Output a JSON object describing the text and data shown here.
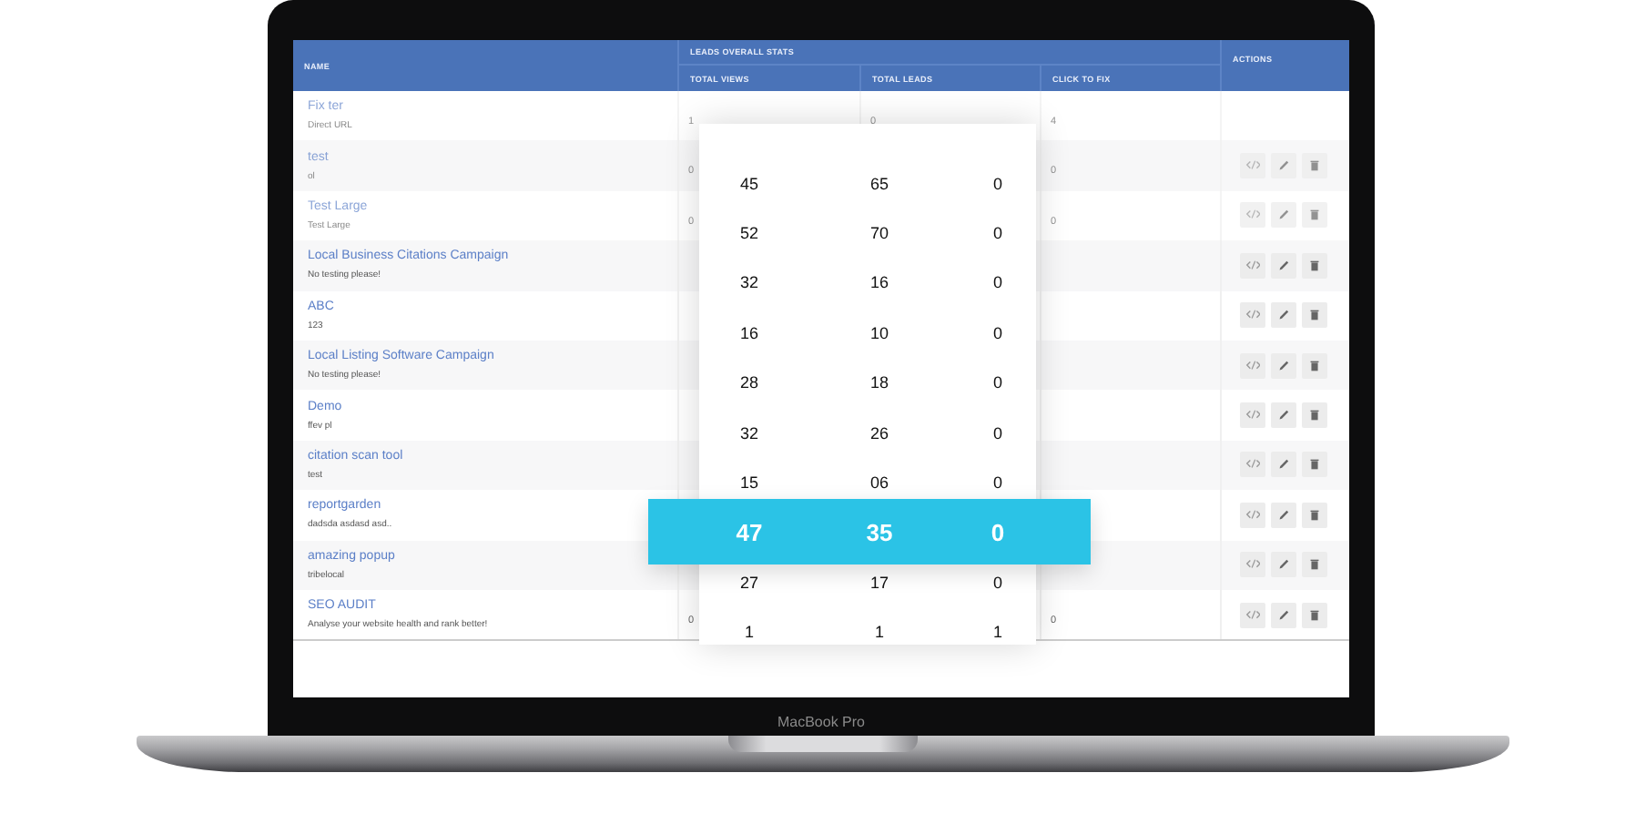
{
  "device": {
    "label": "MacBook Pro"
  },
  "table": {
    "columns": {
      "name": "NAME",
      "group": "LEADS OVERALL STATS",
      "stats": [
        "TOTAL VIEWS",
        "TOTAL LEADS",
        "CLICK TO FIX"
      ],
      "actions": "ACTIONS"
    },
    "rows": [
      {
        "name": "Fix ter",
        "description": "Direct URL",
        "faded": true,
        "has_actions": false,
        "stats": {
          "views": "1",
          "leads": "0",
          "click_to_fix": "4"
        }
      },
      {
        "name": "test",
        "description": "ol",
        "faded": true,
        "has_actions": true,
        "stats": {
          "views": "0",
          "click_to_fix": "0"
        }
      },
      {
        "name": "Test Large",
        "description": "Test Large",
        "faded": true,
        "has_actions": true,
        "stats": {
          "views": "0",
          "click_to_fix": "0"
        }
      },
      {
        "name": "Local Business Citations Campaign",
        "description": "No testing please!",
        "faded": false,
        "has_actions": true
      },
      {
        "name": "ABC",
        "description": "123",
        "faded": false,
        "has_actions": true
      },
      {
        "name": "Local Listing Software Campaign",
        "description": "No testing please!",
        "faded": false,
        "has_actions": true
      },
      {
        "name": "Demo",
        "description": "ffev pl",
        "faded": false,
        "has_actions": true
      },
      {
        "name": "citation scan tool",
        "description": "test",
        "faded": false,
        "has_actions": true
      },
      {
        "name": "reportgarden",
        "description": "dadsda asdasd asd..",
        "faded": false,
        "has_actions": true
      },
      {
        "name": "amazing popup",
        "description": "tribelocal",
        "faded": false,
        "has_actions": true
      },
      {
        "name": "SEO AUDIT",
        "description": "Analyse your website health and rank better!",
        "faded": false,
        "has_actions": true,
        "stats": {
          "views": "0",
          "click_to_fix": "0"
        }
      }
    ]
  },
  "overlay": {
    "rows": [
      {
        "values": [
          "45",
          "65",
          "0"
        ],
        "selected": false
      },
      {
        "values": [
          "52",
          "70",
          "0"
        ],
        "selected": false
      },
      {
        "values": [
          "32",
          "16",
          "0"
        ],
        "selected": false
      },
      {
        "values": [
          "16",
          "10",
          "0"
        ],
        "selected": false
      },
      {
        "values": [
          "28",
          "18",
          "0"
        ],
        "selected": false
      },
      {
        "values": [
          "32",
          "26",
          "0"
        ],
        "selected": false
      },
      {
        "values": [
          "15",
          "06",
          "0"
        ],
        "selected": false
      },
      {
        "values": [
          "47",
          "35",
          "0"
        ],
        "selected": true
      },
      {
        "values": [
          "27",
          "17",
          "0"
        ],
        "selected": false
      },
      {
        "values": [
          "1",
          "1",
          "1"
        ],
        "selected": false
      }
    ]
  }
}
